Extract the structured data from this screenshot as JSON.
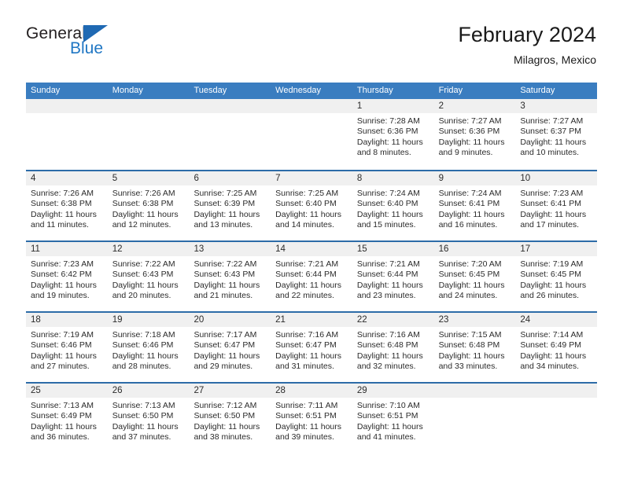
{
  "brand": {
    "name_top": "General",
    "name_bottom": "Blue"
  },
  "header": {
    "title": "February 2024",
    "subtitle": "Milagros, Mexico"
  },
  "colors": {
    "header_blue": "#3a7dc0",
    "row_divider_blue": "#2d6ca8",
    "day_band_gray": "#f0f0f0",
    "logo_blue": "#2077c4",
    "text": "#2b2b2b"
  },
  "weekdays": [
    "Sunday",
    "Monday",
    "Tuesday",
    "Wednesday",
    "Thursday",
    "Friday",
    "Saturday"
  ],
  "labels": {
    "sunrise": "Sunrise:",
    "sunset": "Sunset:",
    "daylight": "Daylight:"
  },
  "weeks": [
    {
      "days": [
        {
          "num": "",
          "empty": true,
          "sunrise": "",
          "sunset": "",
          "daylight": ""
        },
        {
          "num": "",
          "empty": true,
          "sunrise": "",
          "sunset": "",
          "daylight": ""
        },
        {
          "num": "",
          "empty": true,
          "sunrise": "",
          "sunset": "",
          "daylight": ""
        },
        {
          "num": "",
          "empty": true,
          "sunrise": "",
          "sunset": "",
          "daylight": ""
        },
        {
          "num": "1",
          "empty": false,
          "sunrise": "Sunrise: 7:28 AM",
          "sunset": "Sunset: 6:36 PM",
          "daylight": "Daylight: 11 hours and 8 minutes."
        },
        {
          "num": "2",
          "empty": false,
          "sunrise": "Sunrise: 7:27 AM",
          "sunset": "Sunset: 6:36 PM",
          "daylight": "Daylight: 11 hours and 9 minutes."
        },
        {
          "num": "3",
          "empty": false,
          "sunrise": "Sunrise: 7:27 AM",
          "sunset": "Sunset: 6:37 PM",
          "daylight": "Daylight: 11 hours and 10 minutes."
        }
      ]
    },
    {
      "days": [
        {
          "num": "4",
          "empty": false,
          "sunrise": "Sunrise: 7:26 AM",
          "sunset": "Sunset: 6:38 PM",
          "daylight": "Daylight: 11 hours and 11 minutes."
        },
        {
          "num": "5",
          "empty": false,
          "sunrise": "Sunrise: 7:26 AM",
          "sunset": "Sunset: 6:38 PM",
          "daylight": "Daylight: 11 hours and 12 minutes."
        },
        {
          "num": "6",
          "empty": false,
          "sunrise": "Sunrise: 7:25 AM",
          "sunset": "Sunset: 6:39 PM",
          "daylight": "Daylight: 11 hours and 13 minutes."
        },
        {
          "num": "7",
          "empty": false,
          "sunrise": "Sunrise: 7:25 AM",
          "sunset": "Sunset: 6:40 PM",
          "daylight": "Daylight: 11 hours and 14 minutes."
        },
        {
          "num": "8",
          "empty": false,
          "sunrise": "Sunrise: 7:24 AM",
          "sunset": "Sunset: 6:40 PM",
          "daylight": "Daylight: 11 hours and 15 minutes."
        },
        {
          "num": "9",
          "empty": false,
          "sunrise": "Sunrise: 7:24 AM",
          "sunset": "Sunset: 6:41 PM",
          "daylight": "Daylight: 11 hours and 16 minutes."
        },
        {
          "num": "10",
          "empty": false,
          "sunrise": "Sunrise: 7:23 AM",
          "sunset": "Sunset: 6:41 PM",
          "daylight": "Daylight: 11 hours and 17 minutes."
        }
      ]
    },
    {
      "days": [
        {
          "num": "11",
          "empty": false,
          "sunrise": "Sunrise: 7:23 AM",
          "sunset": "Sunset: 6:42 PM",
          "daylight": "Daylight: 11 hours and 19 minutes."
        },
        {
          "num": "12",
          "empty": false,
          "sunrise": "Sunrise: 7:22 AM",
          "sunset": "Sunset: 6:43 PM",
          "daylight": "Daylight: 11 hours and 20 minutes."
        },
        {
          "num": "13",
          "empty": false,
          "sunrise": "Sunrise: 7:22 AM",
          "sunset": "Sunset: 6:43 PM",
          "daylight": "Daylight: 11 hours and 21 minutes."
        },
        {
          "num": "14",
          "empty": false,
          "sunrise": "Sunrise: 7:21 AM",
          "sunset": "Sunset: 6:44 PM",
          "daylight": "Daylight: 11 hours and 22 minutes."
        },
        {
          "num": "15",
          "empty": false,
          "sunrise": "Sunrise: 7:21 AM",
          "sunset": "Sunset: 6:44 PM",
          "daylight": "Daylight: 11 hours and 23 minutes."
        },
        {
          "num": "16",
          "empty": false,
          "sunrise": "Sunrise: 7:20 AM",
          "sunset": "Sunset: 6:45 PM",
          "daylight": "Daylight: 11 hours and 24 minutes."
        },
        {
          "num": "17",
          "empty": false,
          "sunrise": "Sunrise: 7:19 AM",
          "sunset": "Sunset: 6:45 PM",
          "daylight": "Daylight: 11 hours and 26 minutes."
        }
      ]
    },
    {
      "days": [
        {
          "num": "18",
          "empty": false,
          "sunrise": "Sunrise: 7:19 AM",
          "sunset": "Sunset: 6:46 PM",
          "daylight": "Daylight: 11 hours and 27 minutes."
        },
        {
          "num": "19",
          "empty": false,
          "sunrise": "Sunrise: 7:18 AM",
          "sunset": "Sunset: 6:46 PM",
          "daylight": "Daylight: 11 hours and 28 minutes."
        },
        {
          "num": "20",
          "empty": false,
          "sunrise": "Sunrise: 7:17 AM",
          "sunset": "Sunset: 6:47 PM",
          "daylight": "Daylight: 11 hours and 29 minutes."
        },
        {
          "num": "21",
          "empty": false,
          "sunrise": "Sunrise: 7:16 AM",
          "sunset": "Sunset: 6:47 PM",
          "daylight": "Daylight: 11 hours and 31 minutes."
        },
        {
          "num": "22",
          "empty": false,
          "sunrise": "Sunrise: 7:16 AM",
          "sunset": "Sunset: 6:48 PM",
          "daylight": "Daylight: 11 hours and 32 minutes."
        },
        {
          "num": "23",
          "empty": false,
          "sunrise": "Sunrise: 7:15 AM",
          "sunset": "Sunset: 6:48 PM",
          "daylight": "Daylight: 11 hours and 33 minutes."
        },
        {
          "num": "24",
          "empty": false,
          "sunrise": "Sunrise: 7:14 AM",
          "sunset": "Sunset: 6:49 PM",
          "daylight": "Daylight: 11 hours and 34 minutes."
        }
      ]
    },
    {
      "days": [
        {
          "num": "25",
          "empty": false,
          "sunrise": "Sunrise: 7:13 AM",
          "sunset": "Sunset: 6:49 PM",
          "daylight": "Daylight: 11 hours and 36 minutes."
        },
        {
          "num": "26",
          "empty": false,
          "sunrise": "Sunrise: 7:13 AM",
          "sunset": "Sunset: 6:50 PM",
          "daylight": "Daylight: 11 hours and 37 minutes."
        },
        {
          "num": "27",
          "empty": false,
          "sunrise": "Sunrise: 7:12 AM",
          "sunset": "Sunset: 6:50 PM",
          "daylight": "Daylight: 11 hours and 38 minutes."
        },
        {
          "num": "28",
          "empty": false,
          "sunrise": "Sunrise: 7:11 AM",
          "sunset": "Sunset: 6:51 PM",
          "daylight": "Daylight: 11 hours and 39 minutes."
        },
        {
          "num": "29",
          "empty": false,
          "sunrise": "Sunrise: 7:10 AM",
          "sunset": "Sunset: 6:51 PM",
          "daylight": "Daylight: 11 hours and 41 minutes."
        },
        {
          "num": "",
          "empty": true,
          "sunrise": "",
          "sunset": "",
          "daylight": ""
        },
        {
          "num": "",
          "empty": true,
          "sunrise": "",
          "sunset": "",
          "daylight": ""
        }
      ]
    }
  ]
}
